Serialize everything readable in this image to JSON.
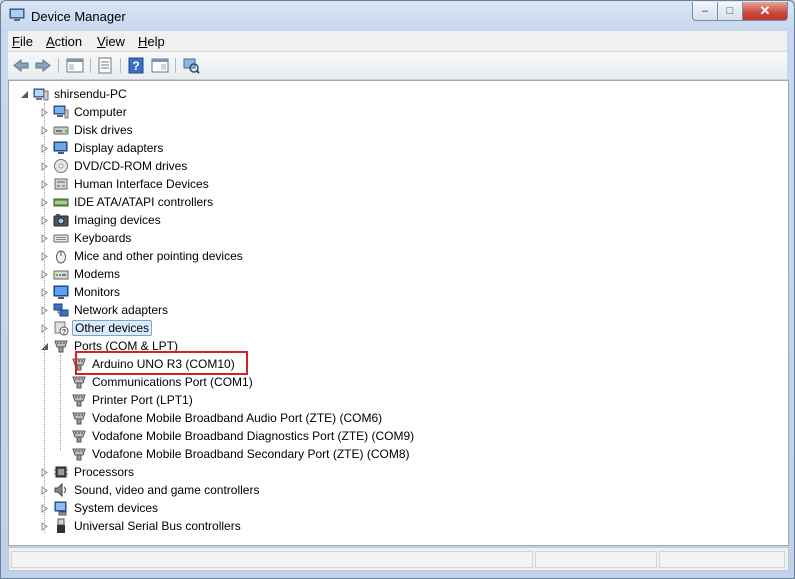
{
  "window": {
    "title": "Device Manager"
  },
  "menu": [
    {
      "label": "File",
      "accel": "F",
      "rest": "ile"
    },
    {
      "label": "Action",
      "accel": "A",
      "rest": "ction"
    },
    {
      "label": "View",
      "accel": "V",
      "rest": "iew"
    },
    {
      "label": "Help",
      "accel": "H",
      "rest": "elp"
    }
  ],
  "toolbar": [
    {
      "icon": "back-arrow-icon"
    },
    {
      "icon": "forward-arrow-icon"
    },
    {
      "icon": "show-hide-console-tree-icon"
    },
    {
      "icon": "properties-icon"
    },
    {
      "icon": "help-icon"
    },
    {
      "icon": "action-pane-icon"
    },
    {
      "icon": "scan-hardware-icon"
    }
  ],
  "tree": {
    "root": "shirsendu-PC",
    "categories": [
      "Computer",
      "Disk drives",
      "Display adapters",
      "DVD/CD-ROM drives",
      "Human Interface Devices",
      "IDE ATA/ATAPI controllers",
      "Imaging devices",
      "Keyboards",
      "Mice and other pointing devices",
      "Modems",
      "Monitors",
      "Network adapters",
      "Other devices",
      "Ports (COM & LPT)"
    ],
    "ports_children": [
      "Arduino UNO R3 (COM10)",
      "Communications Port (COM1)",
      "Printer Port (LPT1)",
      "Vodafone Mobile Broadband Audio Port (ZTE) (COM6)",
      "Vodafone Mobile Broadband Diagnostics Port (ZTE) (COM9)",
      "Vodafone Mobile Broadband Secondary Port (ZTE) (COM8)"
    ],
    "categories_after": [
      "Processors",
      "Sound, video and game controllers",
      "System devices",
      "Universal Serial Bus controllers"
    ],
    "selected": "Other devices",
    "highlighted": "Arduino UNO R3 (COM10)"
  },
  "colors": {
    "highlight_box": "#d52121",
    "selection_bg": "#dcebfc"
  }
}
